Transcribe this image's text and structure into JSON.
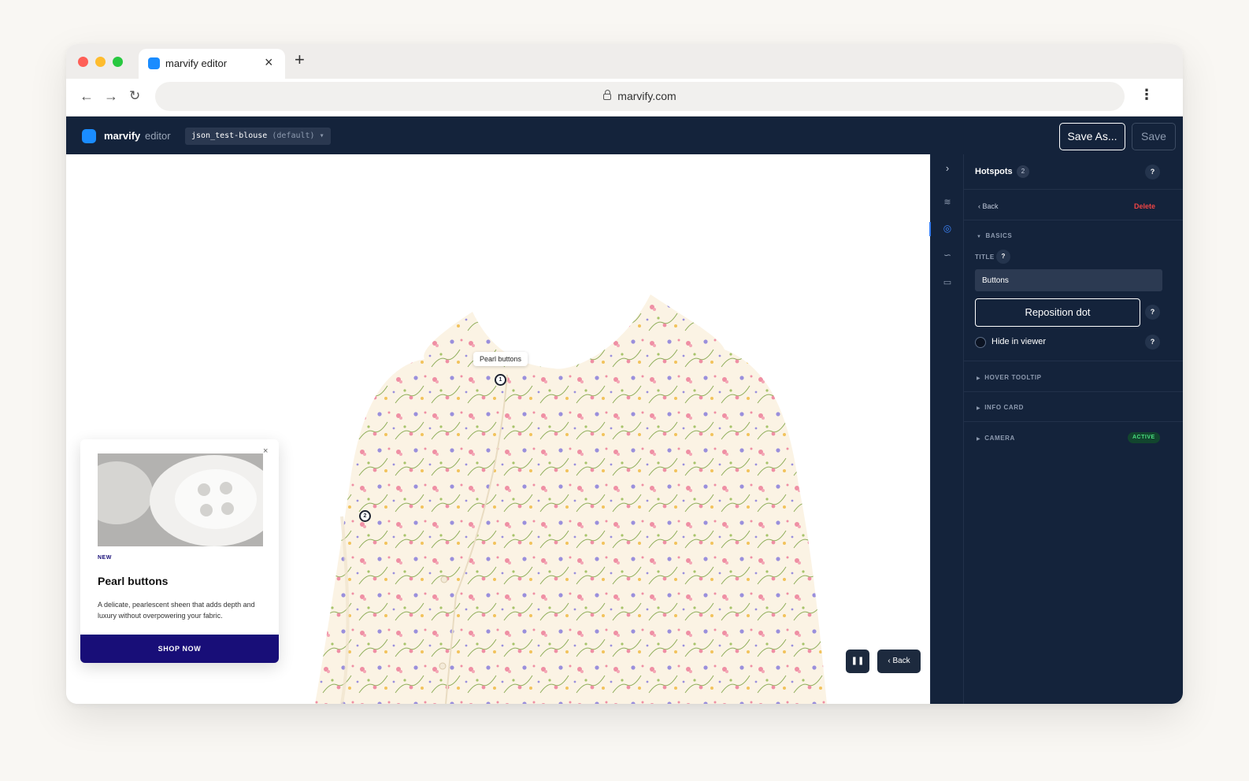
{
  "browser": {
    "tab_title": "marvify editor",
    "url": "marvify.com",
    "colors": {
      "red": "#fe5f57",
      "yellow": "#febc2e",
      "green": "#28c840",
      "favicon": "#1a8cff"
    }
  },
  "app": {
    "brand": "marvify",
    "brand_sub": "editor",
    "project_name": "json_test-blouse",
    "project_tag": "(default)",
    "save_as_label": "Save As...",
    "save_label": "Save",
    "accent": "#1a8cff"
  },
  "canvas": {
    "hotspot_tooltip": "Pearl buttons",
    "hotspots": [
      {
        "number": "1"
      },
      {
        "number": "2"
      }
    ],
    "info_card": {
      "badge": "NEW",
      "title": "Pearl buttons",
      "description": "A delicate, pearlescent sheen that adds depth and luxury without overpowering your fabric.",
      "cta": "SHOP NOW",
      "cta_color": "#180e78"
    },
    "back_label": "Back"
  },
  "panel": {
    "title": "Hotspots",
    "count": "2",
    "back_label": "Back",
    "delete_label": "Delete",
    "sections": {
      "basics": "BASICS",
      "hover_tooltip": "HOVER TOOLTIP",
      "info_card": "INFO CARD",
      "camera": "CAMERA"
    },
    "title_label": "TITLE",
    "title_value": "Buttons",
    "reposition_label": "Reposition dot",
    "hide_label": "Hide in viewer",
    "camera_status": "ACTIVE"
  },
  "icons": {
    "rail": [
      "chevron-right-icon",
      "sliders-icon",
      "target-icon",
      "path-icon",
      "video-camera-icon"
    ]
  }
}
